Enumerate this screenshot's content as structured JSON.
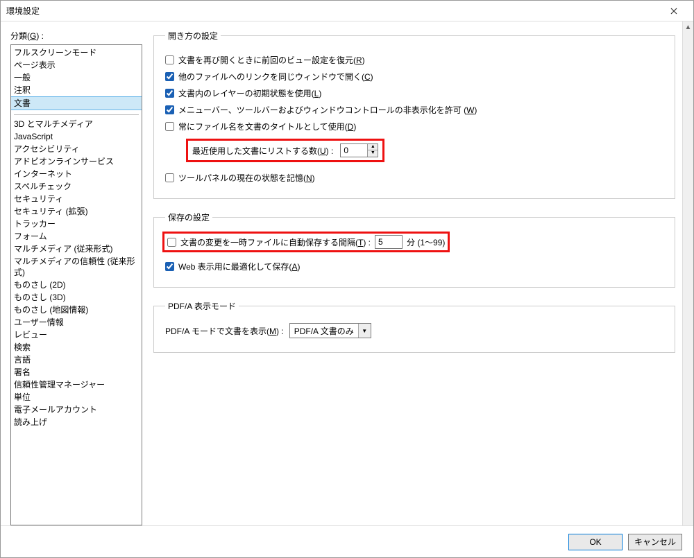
{
  "window": {
    "title": "環境設定"
  },
  "sidebar": {
    "label_html": "分類(<span class='u'>G</span>) :",
    "group1": [
      "フルスクリーンモード",
      "ページ表示",
      "一般",
      "注釈",
      "文書"
    ],
    "selected_index": 4,
    "group2": [
      "3D とマルチメディア",
      "JavaScript",
      "アクセシビリティ",
      "アドビオンラインサービス",
      "インターネット",
      "スペルチェック",
      "セキュリティ",
      "セキュリティ (拡張)",
      "トラッカー",
      "フォーム",
      "マルチメディア (従来形式)",
      "マルチメディアの信頼性 (従来形式)",
      "ものさし (2D)",
      "ものさし (3D)",
      "ものさし (地図情報)",
      "ユーザー情報",
      "レビュー",
      "検索",
      "言語",
      "署名",
      "信頼性管理マネージャー",
      "単位",
      "電子メールアカウント",
      "読み上げ"
    ]
  },
  "open": {
    "legend": "開き方の設定",
    "cb1_html": "文書を再び開くときに前回のビュー設定を復元(<span class='u'>R</span>)",
    "cb1_checked": false,
    "cb2_html": "他のファイルへのリンクを同じウィンドウで開く(<span class='u'>C</span>)",
    "cb2_checked": true,
    "cb3_html": "文書内のレイヤーの初期状態を使用(<span class='u'>L</span>)",
    "cb3_checked": true,
    "cb4_html": "メニューバー、ツールバーおよびウィンドウコントロールの非表示化を許可 (<span class='u'>W</span>)",
    "cb4_checked": true,
    "cb5_html": "常にファイル名を文書のタイトルとして使用(<span class='u'>D</span>)",
    "cb5_checked": false,
    "recent_label_html": "最近使用した文書にリストする数(<span class='u'>U</span>) :",
    "recent_value": "0",
    "cb6_html": "ツールパネルの現在の状態を記憶(<span class='u'>N</span>)",
    "cb6_checked": false
  },
  "save": {
    "legend": "保存の設定",
    "cb1_html": "文書の変更を一時ファイルに自動保存する間隔(<span class='u'>T</span>) :",
    "cb1_checked": false,
    "interval_value": "5",
    "interval_unit": "分 (1～99)",
    "cb2_html": "Web 表示用に最適化して保存(<span class='u'>A</span>)",
    "cb2_checked": true
  },
  "pdfa": {
    "legend": "PDF/A 表示モード",
    "label_html": "PDF/A モードで文書を表示(<span class='u'>M</span>) :",
    "combo_value": "PDF/A 文書のみ"
  },
  "buttons": {
    "ok": "OK",
    "cancel": "キャンセル"
  }
}
